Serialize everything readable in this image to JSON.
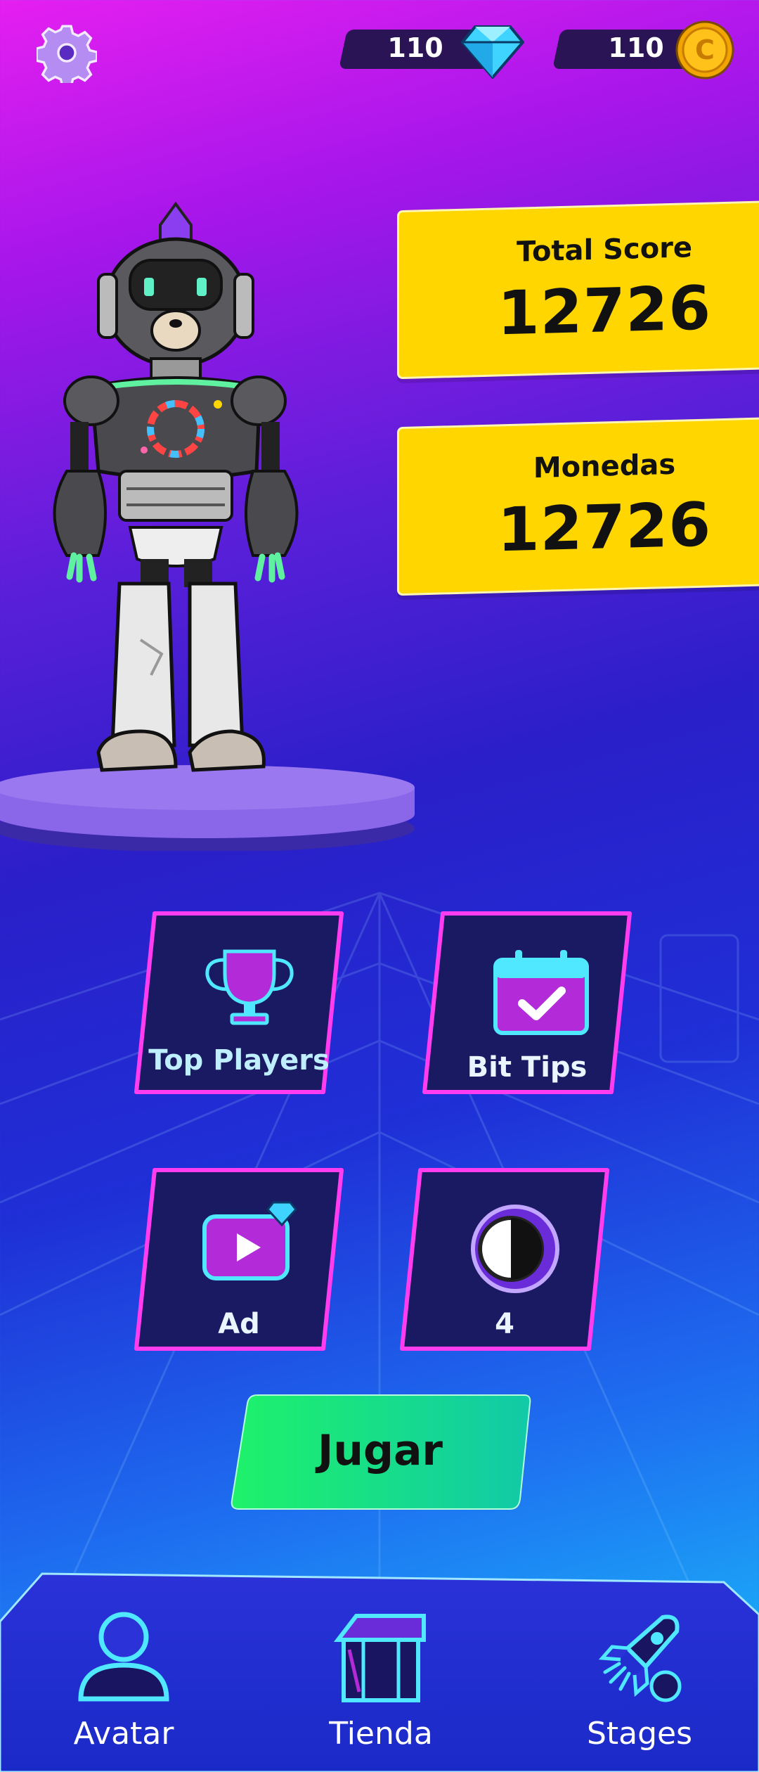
{
  "currencies": {
    "gems": "110",
    "coins": "110",
    "coin_symbol": "C"
  },
  "stats": {
    "total_score_label": "Total Score",
    "total_score_value": "12726",
    "coins_label": "Monedas",
    "coins_value": "12726"
  },
  "menu": {
    "top_players": "Top Players",
    "bit_tips": "Bit Tips",
    "ad": "Ad",
    "count": "4"
  },
  "play_button": "Jugar",
  "nav": {
    "avatar": "Avatar",
    "store": "Tienda",
    "stages": "Stages"
  },
  "colors": {
    "accent_yellow": "#ffd600",
    "play_green": "#1ee87a",
    "tile_border": "#ff3cf0",
    "tile_fill": "#1a1560"
  }
}
